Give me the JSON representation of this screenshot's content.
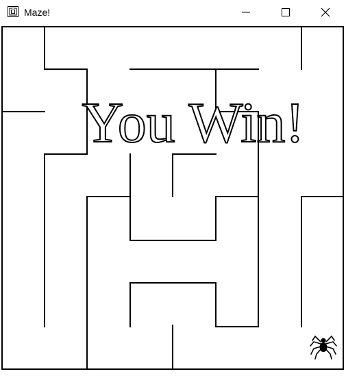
{
  "window": {
    "title": "Maze!",
    "icon": "maze-app-icon",
    "controls": {
      "minimize_icon": "minimize-icon",
      "maximize_icon": "maximize-icon",
      "close_icon": "close-icon"
    }
  },
  "game": {
    "message": "You Win!",
    "player_icon": "spider-icon",
    "colors": {
      "wall": "#000000",
      "background": "#ffffff",
      "message_fill": "#ffffff",
      "message_outline": "#000000"
    }
  }
}
